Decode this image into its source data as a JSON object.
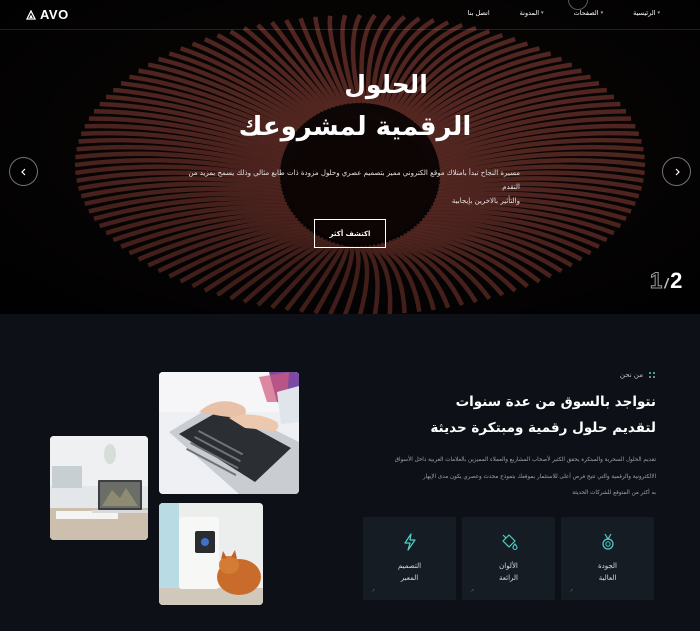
{
  "brand": {
    "name": "AVO"
  },
  "nav": [
    {
      "label": "الرئيسية",
      "has_dropdown": true
    },
    {
      "label": "الصفحات",
      "has_dropdown": true
    },
    {
      "label": "المدونة",
      "has_dropdown": true
    },
    {
      "label": "اتصل بنا",
      "has_dropdown": false
    }
  ],
  "hero": {
    "title_line1": "الحلول",
    "title_line2": "الرقمية لمشروعك",
    "description_line1": "مسيرة النجاح تبدأ بامتلاك موقع الكتروني مميز بتصميم عصري وحلول مزودة ذات طابع مثالي وذلك يسمح بمزيد من التقدم",
    "description_line2": "والتأثير بالاخرين بإيجابية",
    "button_label": "اكتشف أكثر",
    "slide_current": "2",
    "slide_separator": "/",
    "slide_total": "1",
    "prev_icon": "chevron-left-icon",
    "next_icon": "chevron-right-icon"
  },
  "about": {
    "subtitle": "من نحن",
    "title_line1": "نتواجد بالسوق من عدة سنوات",
    "title_line2": "لتقديم حلول رقمية ومبتكرة حديثة",
    "text_line1": "تقديم الحلول السحرية والمبتكرة يحقق الكثير لأصحاب المشاريع والعملاء المميزين بالعلامات الغربية داخل الأسواق",
    "text_line2": "الالكترونية والرقمية والتي تتيح فرص أعلى للاستثمار بموقعك بتموذج محدث وعصري يكون مدى الإبهار",
    "text_line3": "به أكثر من المتوقع للشركات الحديثة",
    "features": [
      {
        "label_line1": "التصميم",
        "label_line2": "المعبر",
        "icon": "lightning-icon"
      },
      {
        "label_line1": "الألوان",
        "label_line2": "الرائعة",
        "icon": "paint-bucket-icon"
      },
      {
        "label_line1": "الجودة",
        "label_line2": "العالية",
        "icon": "medal-icon"
      }
    ]
  },
  "colors": {
    "background": "#0d1117",
    "card": "#161c24",
    "accent": "#4fd1c5",
    "hero_art": "#8a4a3f"
  }
}
